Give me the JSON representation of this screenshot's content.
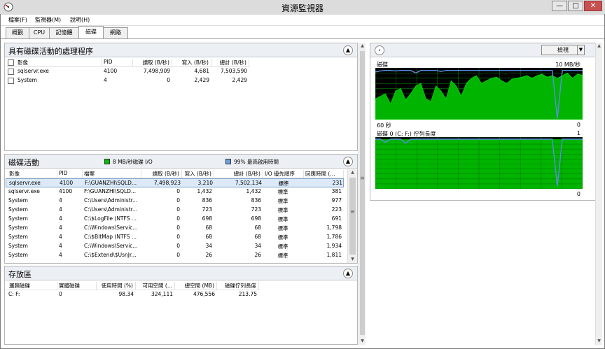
{
  "window": {
    "title": "資源監視器",
    "minimize": "—",
    "maximize": "□",
    "close": "✕",
    "app_icon": "resource-monitor-icon"
  },
  "menu": [
    "檔案(F)",
    "監視器(M)",
    "說明(H)"
  ],
  "tabs": [
    "概觀",
    "CPU",
    "記憶體",
    "磁碟",
    "網路"
  ],
  "selected_tab": "磁碟",
  "processes_panel": {
    "title": "具有磁碟活動的處理程序",
    "columns": [
      "影像",
      "PID",
      "讀取 (B/秒)",
      "寫入 (B/秒)",
      "總計 (B/秒)"
    ],
    "rows": [
      {
        "image": "sqlservr.exe",
        "pid": "4100",
        "read": "7,498,909",
        "write": "4,681",
        "total": "7,503,590"
      },
      {
        "image": "System",
        "pid": "4",
        "read": "0",
        "write": "2,429",
        "total": "2,429"
      }
    ]
  },
  "disk_activity_panel": {
    "title": "磁碟活動",
    "legend_io": "8 MB/秒磁碟 I/O",
    "legend_active": "99% 最高啟用時間",
    "legend_io_color": "#00c000",
    "legend_active_color": "#6aa0e0",
    "columns": [
      "影像",
      "PID",
      "檔案",
      "讀取 (B/秒)",
      "寫入 (B/秒)",
      "總計 (B/秒)",
      "I/O 優先順序",
      "回應時間 (..."
    ],
    "rows": [
      {
        "image": "sqlservr.exe",
        "pid": "4100",
        "file": "F:\\GUANZHI\\SQLD...",
        "read": "7,498,923",
        "write": "3,210",
        "total": "7,502,134",
        "priority": "標準",
        "response": "231"
      },
      {
        "image": "sqlservr.exe",
        "pid": "4100",
        "file": "F:\\GUANZHI\\SQLD...",
        "read": "0",
        "write": "1,432",
        "total": "1,432",
        "priority": "標準",
        "response": "381"
      },
      {
        "image": "System",
        "pid": "4",
        "file": "C:\\Users\\Administr...",
        "read": "0",
        "write": "836",
        "total": "836",
        "priority": "標準",
        "response": "977"
      },
      {
        "image": "System",
        "pid": "4",
        "file": "C:\\Users\\Administr...",
        "read": "0",
        "write": "723",
        "total": "723",
        "priority": "標準",
        "response": "223"
      },
      {
        "image": "System",
        "pid": "4",
        "file": "C:\\$LogFile (NTFS ...",
        "read": "0",
        "write": "698",
        "total": "698",
        "priority": "標準",
        "response": "691"
      },
      {
        "image": "System",
        "pid": "4",
        "file": "C:\\Windows\\Servic...",
        "read": "0",
        "write": "68",
        "total": "68",
        "priority": "標準",
        "response": "1,798"
      },
      {
        "image": "System",
        "pid": "4",
        "file": "C:\\$BitMap (NTFS ...",
        "read": "0",
        "write": "68",
        "total": "68",
        "priority": "標準",
        "response": "1,786"
      },
      {
        "image": "System",
        "pid": "4",
        "file": "C:\\Windows\\Servic...",
        "read": "0",
        "write": "34",
        "total": "34",
        "priority": "標準",
        "response": "1,934"
      },
      {
        "image": "System",
        "pid": "4",
        "file": "C:\\$Extend\\$UsnJr...",
        "read": "0",
        "write": "26",
        "total": "26",
        "priority": "標準",
        "response": "1,811"
      }
    ]
  },
  "storage_panel": {
    "title": "存放區",
    "columns": [
      "邏輯磁碟",
      "實體磁碟",
      "使用時間 (%)",
      "可用空間 (...",
      "總空間 (MB)",
      "磁碟佇列長度"
    ],
    "rows": [
      {
        "logical": "C: F:",
        "physical": "0",
        "active": "98.34",
        "free": "324,111",
        "total": "476,556",
        "queue": "213.75"
      }
    ]
  },
  "graphs": {
    "view_label": "檢視",
    "disk": {
      "title": "磁碟",
      "max": "10 MB/秒",
      "left_bottom": "60 秒",
      "right_bottom": "0"
    },
    "queue": {
      "title": "磁碟 0 (C: F:) 佇列長度",
      "max": "1",
      "right_bottom": "0"
    }
  }
}
